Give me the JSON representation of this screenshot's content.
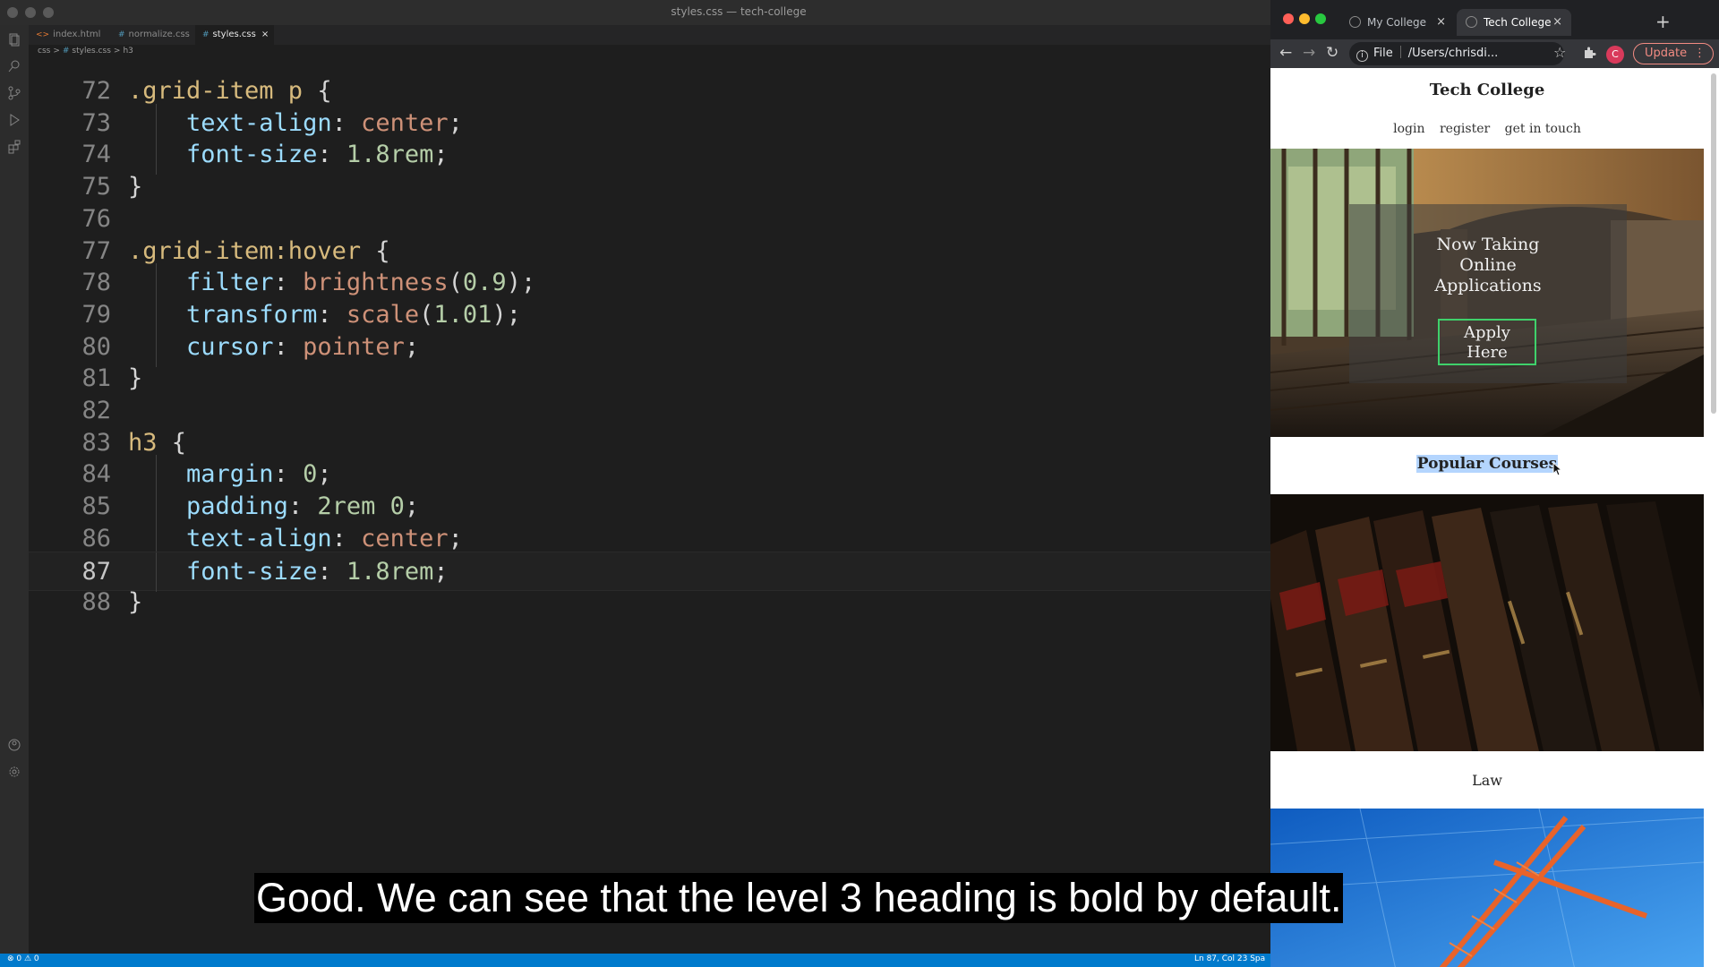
{
  "editor": {
    "window_title": "styles.css — tech-college",
    "tabs": [
      {
        "icon": "<>",
        "label": "index.html"
      },
      {
        "icon": "#",
        "label": "normalize.css"
      },
      {
        "icon": "#",
        "label": "styles.css",
        "close": "×"
      }
    ],
    "breadcrumb": [
      "css",
      ">",
      "#",
      "styles.css",
      ">",
      "h3"
    ],
    "lines": [
      {
        "n": "72",
        "tokens": [
          [
            "sel",
            ".grid-item p "
          ],
          [
            "punc",
            "{"
          ]
        ]
      },
      {
        "n": "73",
        "tokens": [
          [
            "prop",
            "text-align"
          ],
          [
            "punc",
            ": "
          ],
          [
            "val",
            "center"
          ],
          [
            "punc",
            ";"
          ]
        ]
      },
      {
        "n": "74",
        "tokens": [
          [
            "prop",
            "font-size"
          ],
          [
            "punc",
            ": "
          ],
          [
            "num",
            "1.8rem"
          ],
          [
            "punc",
            ";"
          ]
        ]
      },
      {
        "n": "75",
        "tokens": [
          [
            "punc",
            "}"
          ]
        ]
      },
      {
        "n": "76",
        "tokens": []
      },
      {
        "n": "77",
        "tokens": [
          [
            "sel",
            ".grid-item:hover "
          ],
          [
            "punc",
            "{"
          ]
        ]
      },
      {
        "n": "78",
        "tokens": [
          [
            "prop",
            "filter"
          ],
          [
            "punc",
            ": "
          ],
          [
            "val",
            "brightness"
          ],
          [
            "punc",
            "("
          ],
          [
            "num",
            "0.9"
          ],
          [
            "punc",
            ");"
          ]
        ]
      },
      {
        "n": "79",
        "tokens": [
          [
            "prop",
            "transform"
          ],
          [
            "punc",
            ": "
          ],
          [
            "val",
            "scale"
          ],
          [
            "punc",
            "("
          ],
          [
            "num",
            "1.01"
          ],
          [
            "punc",
            ");"
          ]
        ]
      },
      {
        "n": "80",
        "tokens": [
          [
            "prop",
            "cursor"
          ],
          [
            "punc",
            ": "
          ],
          [
            "val",
            "pointer"
          ],
          [
            "punc",
            ";"
          ]
        ]
      },
      {
        "n": "81",
        "tokens": [
          [
            "punc",
            "}"
          ]
        ]
      },
      {
        "n": "82",
        "tokens": []
      },
      {
        "n": "83",
        "tokens": [
          [
            "sel",
            "h3 "
          ],
          [
            "punc",
            "{"
          ]
        ]
      },
      {
        "n": "84",
        "tokens": [
          [
            "prop",
            "margin"
          ],
          [
            "punc",
            ": "
          ],
          [
            "num",
            "0"
          ],
          [
            "punc",
            ";"
          ]
        ]
      },
      {
        "n": "85",
        "tokens": [
          [
            "prop",
            "padding"
          ],
          [
            "punc",
            ": "
          ],
          [
            "num",
            "2rem 0"
          ],
          [
            "punc",
            ";"
          ]
        ]
      },
      {
        "n": "86",
        "tokens": [
          [
            "prop",
            "text-align"
          ],
          [
            "punc",
            ": "
          ],
          [
            "val",
            "center"
          ],
          [
            "punc",
            ";"
          ]
        ]
      },
      {
        "n": "87",
        "tokens": [
          [
            "prop",
            "font-size"
          ],
          [
            "punc",
            ": "
          ],
          [
            "num",
            "1.8rem"
          ],
          [
            "punc",
            ";"
          ]
        ]
      },
      {
        "n": "88",
        "tokens": [
          [
            "punc",
            "}"
          ]
        ]
      }
    ],
    "current_line": "87",
    "indented_lines": [
      "73",
      "74",
      "78",
      "79",
      "80",
      "84",
      "85",
      "86",
      "87"
    ],
    "status_left": "⊗ 0 ⚠ 0",
    "status_right": "Ln 87, Col 23   Spa"
  },
  "browser": {
    "tabs": [
      {
        "label": "My College",
        "close": "×"
      },
      {
        "label": "Tech College",
        "close": "×"
      }
    ],
    "new_tab": "+",
    "nav": {
      "back": "←",
      "forward": "→",
      "reload": "↻"
    },
    "omnibox_scheme": "File",
    "omnibox_path": "/Users/chrisdi...",
    "star": "☆",
    "extensions_icon": "puzzle-icon",
    "avatar_letter": "C",
    "update_label": "Update",
    "update_menu": "⋮"
  },
  "page": {
    "site_title": "Tech College",
    "nav_links": [
      "login",
      "register",
      "get in touch"
    ],
    "hero_lines": [
      "Now Taking",
      "Online",
      "Applications"
    ],
    "apply_lines": [
      "Apply",
      "Here"
    ],
    "popular_heading": "Popular Courses",
    "course_caption": "Law"
  },
  "subtitle": "Good. We can see that the level 3 heading is bold by default.",
  "colors": {
    "statusbar": "#007acc",
    "selector": "#d7ba7d",
    "property": "#9cdcfe",
    "value": "#ce9178",
    "number": "#b5cea8",
    "apply_border": "#3fd16b",
    "selection": "#b4d5fe"
  }
}
